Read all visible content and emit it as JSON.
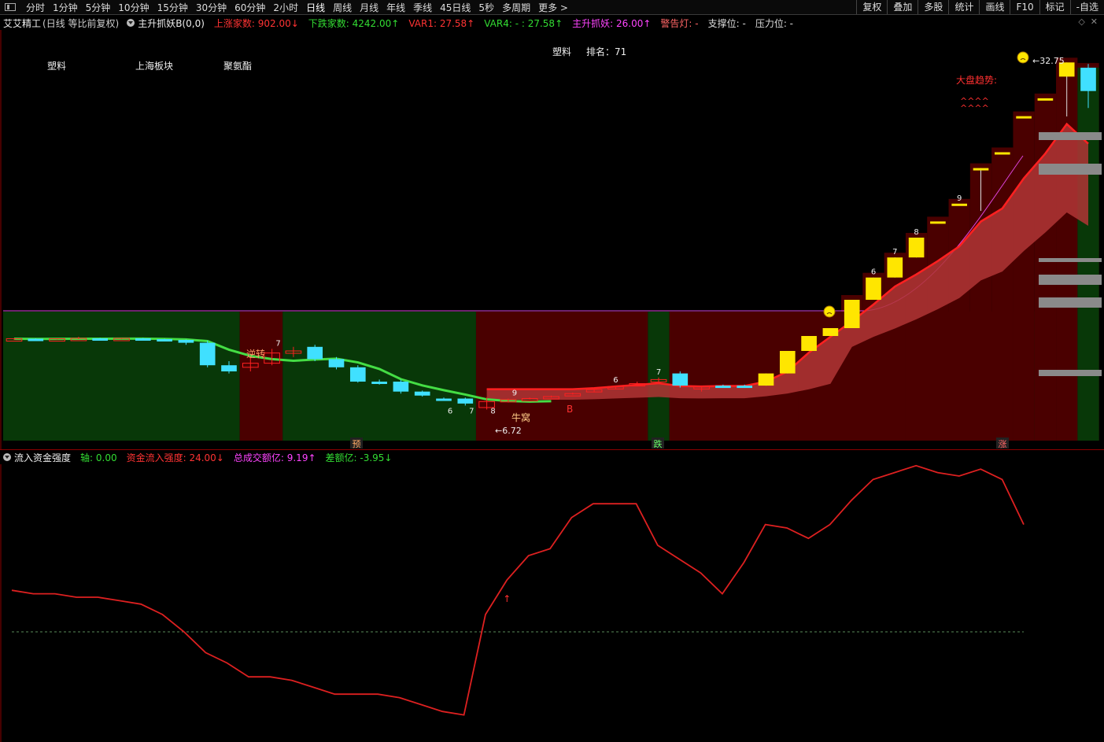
{
  "toolbar": {
    "periods": [
      "分时",
      "1分钟",
      "5分钟",
      "10分钟",
      "15分钟",
      "30分钟",
      "60分钟",
      "2小时",
      "日线",
      "周线",
      "月线",
      "年线",
      "季线",
      "45日线",
      "5秒",
      "多周期",
      "更多 >"
    ],
    "active": "日线",
    "right_tools": [
      "复权",
      "叠加",
      "多股",
      "统计",
      "画线",
      "F10",
      "标记",
      "-自选"
    ]
  },
  "main_header": {
    "stock": "艾艾精工",
    "mode": "(日线 等比前复权)",
    "indicator": "主升抓妖B(0,0)",
    "items": [
      {
        "label": "上涨家数: 902.00↓",
        "color": "#ff3333"
      },
      {
        "label": "下跌家数: 4242.00↑",
        "color": "#33dd33"
      },
      {
        "label": "VAR1: 27.58↑",
        "color": "#ff3333"
      },
      {
        "label": "VAR4: - : 27.58↑",
        "color": "#33dd33"
      },
      {
        "label": "主升抓妖: 26.00↑",
        "color": "#ff44ff"
      },
      {
        "label": "警告灯: -",
        "color": "#ff6666"
      },
      {
        "label": "支撑位: -",
        "color": "#dddddd"
      },
      {
        "label": "压力位: -",
        "color": "#dddddd"
      }
    ]
  },
  "chart_labels": {
    "sector1": "塑料",
    "sector2": "上海板块",
    "sector3": "聚氨酯",
    "rank_sector": "塑料",
    "rank_text": "排名：71",
    "high_price": "32.75",
    "low_price": "6.72",
    "trend_label": "大盘趋势:",
    "reversal": "逆转",
    "niu_wo": "牛窝",
    "b_mark": "B",
    "yu_mark": "预",
    "die_mark": "跌",
    "zhang_mark": "涨",
    "arrows": "^^^^"
  },
  "candles": [
    {
      "o": 6.74,
      "h": 6.76,
      "l": 6.72,
      "c": 6.75,
      "color": "red"
    },
    {
      "o": 6.75,
      "h": 6.76,
      "l": 6.73,
      "c": 6.74,
      "color": "cyan"
    },
    {
      "o": 6.74,
      "h": 6.76,
      "l": 6.73,
      "c": 6.75,
      "color": "red"
    },
    {
      "o": 6.75,
      "h": 6.8,
      "l": 6.74,
      "c": 6.76,
      "color": "red"
    },
    {
      "o": 6.76,
      "h": 6.77,
      "l": 6.74,
      "c": 6.75,
      "color": "cyan"
    },
    {
      "o": 6.75,
      "h": 6.77,
      "l": 6.74,
      "c": 6.76,
      "color": "red"
    },
    {
      "o": 6.76,
      "h": 6.77,
      "l": 6.73,
      "c": 6.74,
      "color": "cyan"
    },
    {
      "o": 6.74,
      "h": 6.75,
      "l": 6.71,
      "c": 6.72,
      "color": "cyan"
    },
    {
      "o": 6.72,
      "h": 6.73,
      "l": 6.68,
      "c": 6.69,
      "color": "cyan"
    },
    {
      "o": 6.69,
      "h": 6.7,
      "l": 6.57,
      "c": 6.58,
      "color": "cyan"
    },
    {
      "o": 6.58,
      "h": 6.6,
      "l": 6.54,
      "c": 6.55,
      "color": "cyan"
    },
    {
      "o": 6.57,
      "h": 6.62,
      "l": 6.55,
      "c": 6.59,
      "color": "red"
    },
    {
      "o": 6.59,
      "h": 6.66,
      "l": 6.58,
      "c": 6.64,
      "color": "red"
    },
    {
      "o": 6.64,
      "h": 6.67,
      "l": 6.62,
      "c": 6.65,
      "color": "red"
    },
    {
      "o": 6.67,
      "h": 6.68,
      "l": 6.6,
      "c": 6.61,
      "color": "cyan"
    },
    {
      "o": 6.61,
      "h": 6.62,
      "l": 6.56,
      "c": 6.57,
      "color": "cyan"
    },
    {
      "o": 6.57,
      "h": 6.58,
      "l": 6.49,
      "c": 6.5,
      "color": "cyan"
    },
    {
      "o": 6.5,
      "h": 6.51,
      "l": 6.47,
      "c": 6.48,
      "color": "cyan"
    },
    {
      "o": 6.5,
      "h": 6.51,
      "l": 6.38,
      "c": 6.4,
      "color": "cyan"
    },
    {
      "o": 6.4,
      "h": 6.41,
      "l": 6.35,
      "c": 6.36,
      "color": "cyan"
    },
    {
      "o": 6.33,
      "h": 6.34,
      "l": 6.32,
      "c": 6.33,
      "color": "cyan"
    },
    {
      "o": 6.33,
      "h": 6.34,
      "l": 6.26,
      "c": 6.28,
      "color": "cyan"
    },
    {
      "o": 6.3,
      "h": 6.34,
      "l": 6.22,
      "c": 6.24,
      "color": "red"
    },
    {
      "o": 6.31,
      "h": 6.33,
      "l": 6.29,
      "c": 6.32,
      "color": "red"
    },
    {
      "o": 6.33,
      "h": 6.34,
      "l": 6.32,
      "c": 6.33,
      "color": "red"
    },
    {
      "o": 6.35,
      "h": 6.36,
      "l": 6.34,
      "c": 6.35,
      "color": "red"
    },
    {
      "o": 6.37,
      "h": 6.39,
      "l": 6.37,
      "c": 6.38,
      "color": "red"
    },
    {
      "o": 6.41,
      "h": 6.43,
      "l": 6.4,
      "c": 6.42,
      "color": "red"
    },
    {
      "o": 6.44,
      "h": 6.46,
      "l": 6.43,
      "c": 6.45,
      "color": "red"
    },
    {
      "o": 6.47,
      "h": 6.5,
      "l": 6.46,
      "c": 6.48,
      "color": "red"
    },
    {
      "o": 6.5,
      "h": 6.52,
      "l": 6.48,
      "c": 6.51,
      "color": "red"
    },
    {
      "o": 6.54,
      "h": 6.55,
      "l": 6.44,
      "c": 6.46,
      "color": "cyan"
    },
    {
      "o": 6.44,
      "h": 6.46,
      "l": 6.4,
      "c": 6.45,
      "color": "red"
    },
    {
      "o": 6.46,
      "h": 6.47,
      "l": 6.45,
      "c": 6.46,
      "color": "cyan"
    },
    {
      "o": 6.46,
      "h": 6.47,
      "l": 6.45,
      "c": 6.46,
      "color": "cyan"
    },
    {
      "o": 6.46,
      "h": 6.54,
      "l": 6.46,
      "c": 6.54,
      "color": "yellow"
    },
    {
      "o": 6.54,
      "h": 6.65,
      "l": 6.54,
      "c": 6.65,
      "color": "yellow"
    },
    {
      "o": 6.65,
      "h": 6.82,
      "l": 6.65,
      "c": 6.82,
      "color": "yellow"
    },
    {
      "o": 6.82,
      "h": 7.02,
      "l": 6.82,
      "c": 7.02,
      "color": "yellow"
    },
    {
      "o": 7.02,
      "h": 7.74,
      "l": 7.02,
      "c": 7.74,
      "color": "yellow"
    },
    {
      "o": 7.74,
      "h": 8.51,
      "l": 7.74,
      "c": 8.51,
      "color": "yellow"
    },
    {
      "o": 8.51,
      "h": 9.36,
      "l": 8.51,
      "c": 9.36,
      "color": "yellow"
    },
    {
      "o": 9.36,
      "h": 10.3,
      "l": 9.36,
      "c": 10.3,
      "color": "yellow"
    },
    {
      "o": 11.33,
      "h": 11.33,
      "l": 11.33,
      "c": 11.33,
      "color": "yellow"
    },
    {
      "o": 12.46,
      "h": 12.46,
      "l": 12.46,
      "c": 12.46,
      "color": "yellow"
    },
    {
      "o": 15.08,
      "h": 15.08,
      "l": 12.0,
      "c": 15.08,
      "color": "yellow"
    },
    {
      "o": 16.59,
      "h": 16.59,
      "l": 16.59,
      "c": 16.59,
      "color": "yellow"
    },
    {
      "o": 20.07,
      "h": 20.07,
      "l": 20.07,
      "c": 20.07,
      "color": "yellow"
    },
    {
      "o": 24.29,
      "h": 24.29,
      "l": 24.29,
      "c": 24.29,
      "color": "yellow"
    },
    {
      "o": 32.75,
      "h": 32.75,
      "l": 20.0,
      "c": 29.4,
      "color": "yellow"
    },
    {
      "o": 31.5,
      "h": 32.4,
      "l": 22.0,
      "c": 26.0,
      "color": "cyan"
    }
  ],
  "candle_numbers": [
    {
      "i": 12,
      "t": "7"
    },
    {
      "i": 20,
      "t": "6"
    },
    {
      "i": 21,
      "t": "7"
    },
    {
      "i": 22,
      "t": "8"
    },
    {
      "i": 23,
      "t": "9"
    },
    {
      "i": 28,
      "t": "6"
    },
    {
      "i": 30,
      "t": "7"
    },
    {
      "i": 40,
      "t": "6"
    },
    {
      "i": 41,
      "t": "7"
    },
    {
      "i": 42,
      "t": "8"
    },
    {
      "i": 44,
      "t": "9"
    }
  ],
  "sub_header": {
    "title": "流入资金强度",
    "items": [
      {
        "label": "轴: 0.00",
        "color": "#33dd33"
      },
      {
        "label": "资金流入强度: 24.00↓",
        "color": "#ff3333"
      },
      {
        "label": "总成交额亿: 9.19↑",
        "color": "#ff44ff"
      },
      {
        "label": "差额亿: -3.95↓",
        "color": "#33dd33"
      }
    ]
  },
  "flow_strength": [
    42,
    41,
    41,
    40,
    40,
    39,
    38,
    35,
    30,
    24,
    21,
    17,
    17,
    16,
    14,
    12,
    12,
    12,
    11,
    9,
    7,
    6,
    35,
    45,
    52,
    54,
    63,
    67,
    67,
    67,
    55,
    51,
    47,
    41,
    50,
    61,
    60,
    57,
    61,
    68,
    74,
    76,
    78,
    76,
    75,
    77,
    74,
    61
  ],
  "colors": {
    "up": "#ff2020",
    "down": "#40e0ff",
    "yellow": "#ffe600",
    "green_ma": "#44dd44",
    "pink_line": "#dd44dd",
    "bg_green": "#083808",
    "bg_red": "#4a0000"
  }
}
